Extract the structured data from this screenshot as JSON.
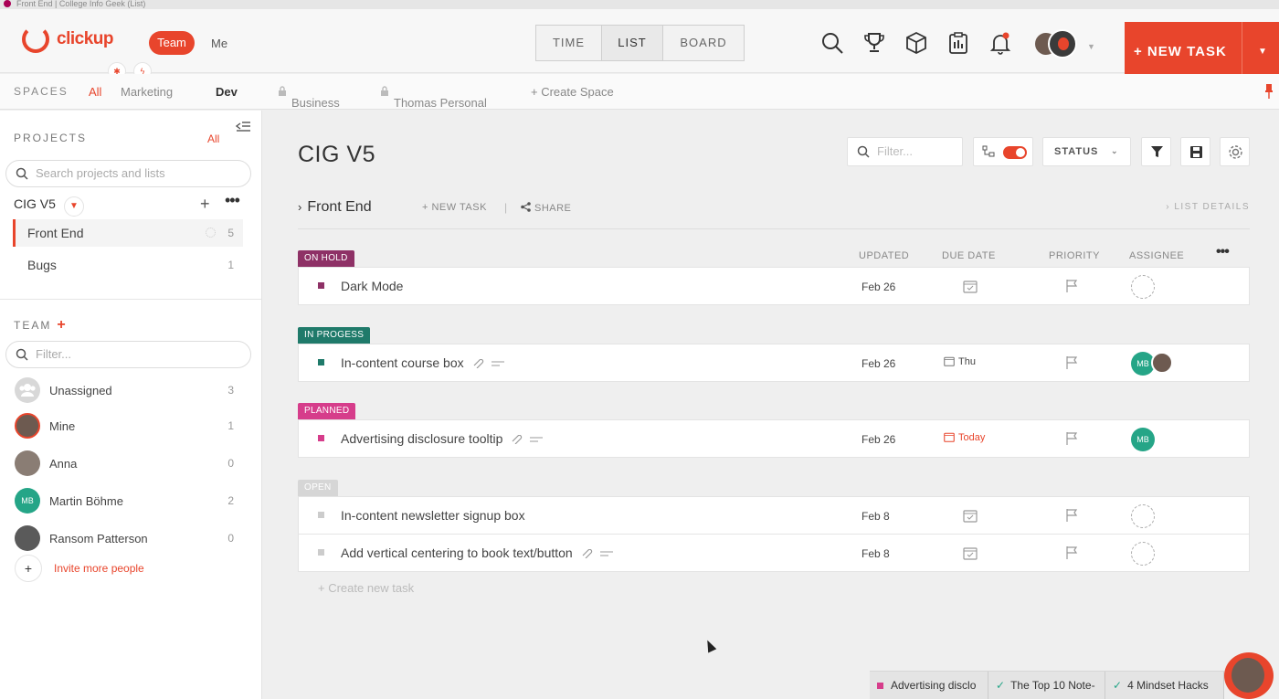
{
  "window": {
    "title": "Front End | College Info Geek (List)"
  },
  "brand": {
    "name": "clickup",
    "accent": "#e8452c"
  },
  "header": {
    "team_label": "Team",
    "me_label": "Me",
    "view_tabs": [
      "TIME",
      "LIST",
      "BOARD"
    ],
    "active_view": "LIST",
    "new_task_label": "+ NEW TASK",
    "icons": [
      "search-icon",
      "trophy-icon",
      "box-icon",
      "clipboard-icon",
      "bell-icon"
    ]
  },
  "spaces": {
    "label": "SPACES",
    "items": [
      "All",
      "Marketing",
      "Dev",
      "Business",
      "Thomas Personal",
      "+ Create Space"
    ],
    "active": "Dev"
  },
  "sidebar": {
    "projects_label": "PROJECTS",
    "projects_all": "All",
    "search_placeholder": "Search projects and lists",
    "project_name": "CIG V5",
    "lists": [
      {
        "label": "Front End",
        "count": "5"
      },
      {
        "label": "Bugs",
        "count": "1"
      }
    ],
    "team_label": "TEAM",
    "team_filter_placeholder": "Filter...",
    "members": [
      {
        "name": "Unassigned",
        "count": "3"
      },
      {
        "name": "Mine",
        "count": "1"
      },
      {
        "name": "Anna",
        "count": "0"
      },
      {
        "name": "Martin Böhme",
        "count": "2",
        "initials": "MB"
      },
      {
        "name": "Ransom Patterson",
        "count": "0"
      }
    ],
    "invite_label": "Invite more people"
  },
  "main": {
    "title": "CIG V5",
    "filter_placeholder": "Filter...",
    "status_label": "STATUS",
    "list_name": "Front End",
    "new_task_link": "+ NEW TASK",
    "share_link": "SHARE",
    "list_details": "LIST DETAILS",
    "columns": [
      "UPDATED",
      "DUE DATE",
      "PRIORITY",
      "ASSIGNEE"
    ],
    "groups": [
      {
        "label": "ON HOLD",
        "color": "#8e3166",
        "tasks": [
          {
            "title": "Dark Mode",
            "updated": "Feb 26",
            "due": "",
            "assignee": "none"
          }
        ]
      },
      {
        "label": "IN PROGESS",
        "color": "#1f7a6a",
        "tasks": [
          {
            "title": "In-content course box",
            "updated": "Feb 26",
            "due": "Thu",
            "assignee": "MB"
          }
        ]
      },
      {
        "label": "PLANNED",
        "color": "#d63d8b",
        "tasks": [
          {
            "title": "Advertising disclosure tooltip",
            "updated": "Feb 26",
            "due": "Today",
            "assignee": "MB"
          }
        ]
      },
      {
        "label": "OPEN",
        "color": "#d6d6d6",
        "tasks": [
          {
            "title": "In-content newsletter signup box",
            "updated": "Feb 8",
            "due": "",
            "assignee": "none"
          },
          {
            "title": "Add vertical centering to book text/button",
            "updated": "Feb 8",
            "due": "",
            "assignee": "none"
          }
        ]
      }
    ],
    "create_task": "+ Create new task"
  },
  "bottom_tabs": [
    "Advertising disclo",
    "The Top 10 Note-",
    "4 Mindset Hacks"
  ]
}
